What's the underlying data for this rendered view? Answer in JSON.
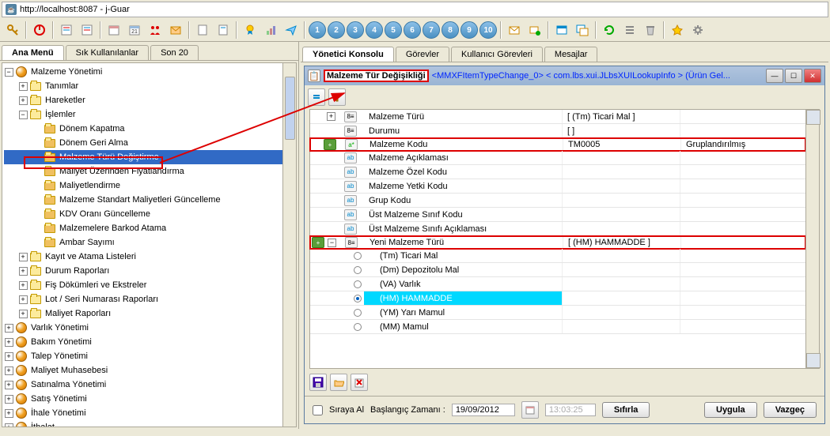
{
  "address": "http://localhost:8087 - j-Guar",
  "left_tabs": [
    "Ana Menü",
    "Sık Kullanılanlar",
    "Son 20"
  ],
  "left_tab_active": 0,
  "right_tabs": [
    "Yönetici Konsolu",
    "Görevler",
    "Kullanıcı Görevleri",
    "Mesajlar"
  ],
  "right_tab_active": 0,
  "tree": [
    {
      "indent": 0,
      "exp": "-",
      "icon": "circle",
      "label": "Malzeme Yönetimi"
    },
    {
      "indent": 1,
      "exp": "+",
      "icon": "folder",
      "label": "Tanımlar"
    },
    {
      "indent": 1,
      "exp": "+",
      "icon": "folder",
      "label": "Hareketler"
    },
    {
      "indent": 1,
      "exp": "-",
      "icon": "folder",
      "label": "İşlemler"
    },
    {
      "indent": 2,
      "exp": "",
      "icon": "sfolder",
      "label": "Dönem Kapatma"
    },
    {
      "indent": 2,
      "exp": "",
      "icon": "sfolder",
      "label": "Dönem Geri Alma"
    },
    {
      "indent": 2,
      "exp": "",
      "icon": "sfolder",
      "label": "Malzeme Türü Değiştirme",
      "selected": true
    },
    {
      "indent": 2,
      "exp": "",
      "icon": "sfolder",
      "label": "Maliyet Üzerinden Fiyatlandırma"
    },
    {
      "indent": 2,
      "exp": "",
      "icon": "sfolder",
      "label": "Maliyetlendirme"
    },
    {
      "indent": 2,
      "exp": "",
      "icon": "sfolder",
      "label": "Malzeme Standart Maliyetleri Güncelleme"
    },
    {
      "indent": 2,
      "exp": "",
      "icon": "sfolder",
      "label": "KDV Oranı Güncelleme"
    },
    {
      "indent": 2,
      "exp": "",
      "icon": "sfolder",
      "label": "Malzemelere Barkod Atama"
    },
    {
      "indent": 2,
      "exp": "",
      "icon": "sfolder",
      "label": "Ambar Sayımı"
    },
    {
      "indent": 1,
      "exp": "+",
      "icon": "folder",
      "label": "Kayıt ve Atama Listeleri"
    },
    {
      "indent": 1,
      "exp": "+",
      "icon": "folder",
      "label": "Durum Raporları"
    },
    {
      "indent": 1,
      "exp": "+",
      "icon": "folder",
      "label": "Fiş Dökümleri ve Ekstreler"
    },
    {
      "indent": 1,
      "exp": "+",
      "icon": "folder",
      "label": "Lot / Seri Numarası Raporları"
    },
    {
      "indent": 1,
      "exp": "+",
      "icon": "folder",
      "label": "Maliyet Raporları"
    },
    {
      "indent": 0,
      "exp": "+",
      "icon": "circle",
      "label": "Varlık Yönetimi"
    },
    {
      "indent": 0,
      "exp": "+",
      "icon": "circle",
      "label": "Bakım Yönetimi"
    },
    {
      "indent": 0,
      "exp": "+",
      "icon": "circle",
      "label": "Talep Yönetimi"
    },
    {
      "indent": 0,
      "exp": "+",
      "icon": "circle",
      "label": "Maliyet Muhasebesi"
    },
    {
      "indent": 0,
      "exp": "+",
      "icon": "circle",
      "label": "Satınalma Yönetimi"
    },
    {
      "indent": 0,
      "exp": "+",
      "icon": "circle",
      "label": "Satış Yönetimi"
    },
    {
      "indent": 0,
      "exp": "+",
      "icon": "circle",
      "label": "İhale Yönetimi"
    },
    {
      "indent": 0,
      "exp": "+",
      "icon": "circle",
      "label": "İthalat"
    }
  ],
  "modal": {
    "title_main": "Malzeme Tür Değişikliği",
    "title_suffix": "<MMXFItemTypeChange_0> < com.lbs.xui.JLbsXUILookupInfo > (Ürün Gel...",
    "rows": [
      {
        "toggle": "+",
        "type": "8=",
        "label": "Malzeme Türü",
        "value": "[ (Tm) Ticari Mal ]",
        "extra": ""
      },
      {
        "toggle": "",
        "type": "8=",
        "label": "Durumu",
        "value": "[ ]",
        "extra": ""
      },
      {
        "toggle": "g",
        "type": "a*",
        "label": "Malzeme Kodu",
        "value": "TM0005",
        "extra": "Gruplandırılmış",
        "hl": "red"
      },
      {
        "toggle": "",
        "type": "ab",
        "label": "Malzeme Açıklaması",
        "value": "",
        "extra": ""
      },
      {
        "toggle": "",
        "type": "ab",
        "label": "Malzeme Özel Kodu",
        "value": "",
        "extra": ""
      },
      {
        "toggle": "",
        "type": "ab",
        "label": "Malzeme Yetki Kodu",
        "value": "",
        "extra": ""
      },
      {
        "toggle": "",
        "type": "ab",
        "label": "Grup Kodu",
        "value": "",
        "extra": ""
      },
      {
        "toggle": "",
        "type": "ab",
        "label": "Üst Malzeme Sınıf Kodu",
        "value": "",
        "extra": ""
      },
      {
        "toggle": "",
        "type": "ab",
        "label": "Üst Malzeme Sınıfı Açıklaması",
        "value": "",
        "extra": ""
      },
      {
        "toggle": "g-",
        "type": "8=",
        "label": "Yeni Malzeme Türü",
        "value": "[ (HM) HAMMADDE ]",
        "extra": "",
        "hl": "red"
      },
      {
        "toggle": "",
        "type": "o",
        "label": "(Tm) Ticari Mal",
        "value": "",
        "extra": "",
        "sub": true
      },
      {
        "toggle": "",
        "type": "o",
        "label": "(Dm) Depozitolu Mal",
        "value": "",
        "extra": "",
        "sub": true
      },
      {
        "toggle": "",
        "type": "o",
        "label": "(VA) Varlık",
        "value": "",
        "extra": "",
        "sub": true
      },
      {
        "toggle": "",
        "type": "o-sel",
        "label": "(HM) HAMMADDE",
        "value": "",
        "extra": "",
        "sub": true,
        "hl": "cyan"
      },
      {
        "toggle": "",
        "type": "o",
        "label": "(YM) Yarı Mamul",
        "value": "",
        "extra": "",
        "sub": true
      },
      {
        "toggle": "",
        "type": "o",
        "label": "(MM) Mamul",
        "value": "",
        "extra": "",
        "sub": true
      }
    ]
  },
  "footer": {
    "queue_label": "Sıraya Al",
    "start_label": "Başlangıç Zamanı :",
    "date_value": "19/09/2012",
    "time_value": "13:03:25",
    "reset_label": "Sıfırla",
    "apply_label": "Uygula",
    "cancel_label": "Vazgeç"
  }
}
